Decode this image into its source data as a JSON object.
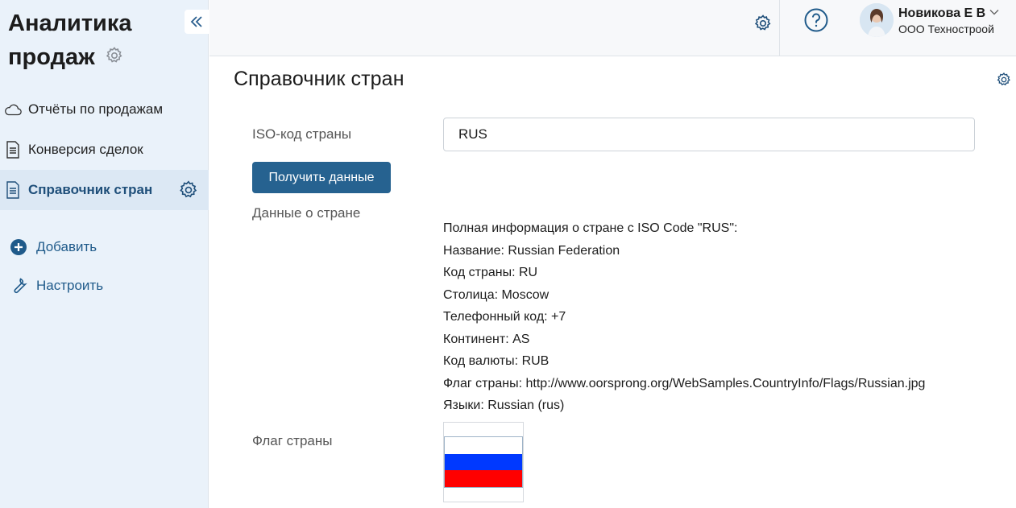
{
  "app": {
    "title": "Аналитика продаж"
  },
  "sidebar": {
    "items": [
      {
        "label": "Отчёты по продажам",
        "icon": "cloud-icon",
        "active": false
      },
      {
        "label": "Конверсия сделок",
        "icon": "document-icon",
        "active": false
      },
      {
        "label": "Справочник стран",
        "icon": "document-icon",
        "active": true
      }
    ],
    "actions": [
      {
        "label": "Добавить",
        "icon": "plus-circle-icon"
      },
      {
        "label": "Настроить",
        "icon": "wrench-icon"
      }
    ]
  },
  "header": {
    "user_name": "Новикова Е В",
    "user_org": "ООО Техностроой"
  },
  "page": {
    "title": "Справочник стран",
    "iso_label": "ISO-код страны",
    "iso_value": "RUS",
    "get_button": "Получить данные",
    "data_label": "Данные о стране",
    "info_lines": [
      "Полная информация о стране с ISO Code \"RUS\":",
      "Название: Russian Federation",
      "Код страны: RU",
      "Столица: Moscow",
      "Телефонный код: +7",
      "Континент: AS",
      "Код валюты: RUB",
      "Флаг страны: http://www.oorsprong.org/WebSamples.CountryInfo/Flags/Russian.jpg",
      "Языки: Russian (rus)"
    ],
    "flag_label": "Флаг страны",
    "flag_colors": [
      "#ffffff",
      "#0039ff",
      "#ff0000"
    ]
  },
  "colors": {
    "accent": "#266290",
    "sidebar_bg": "#eaf2fa",
    "active_bg": "#dce8f4"
  }
}
